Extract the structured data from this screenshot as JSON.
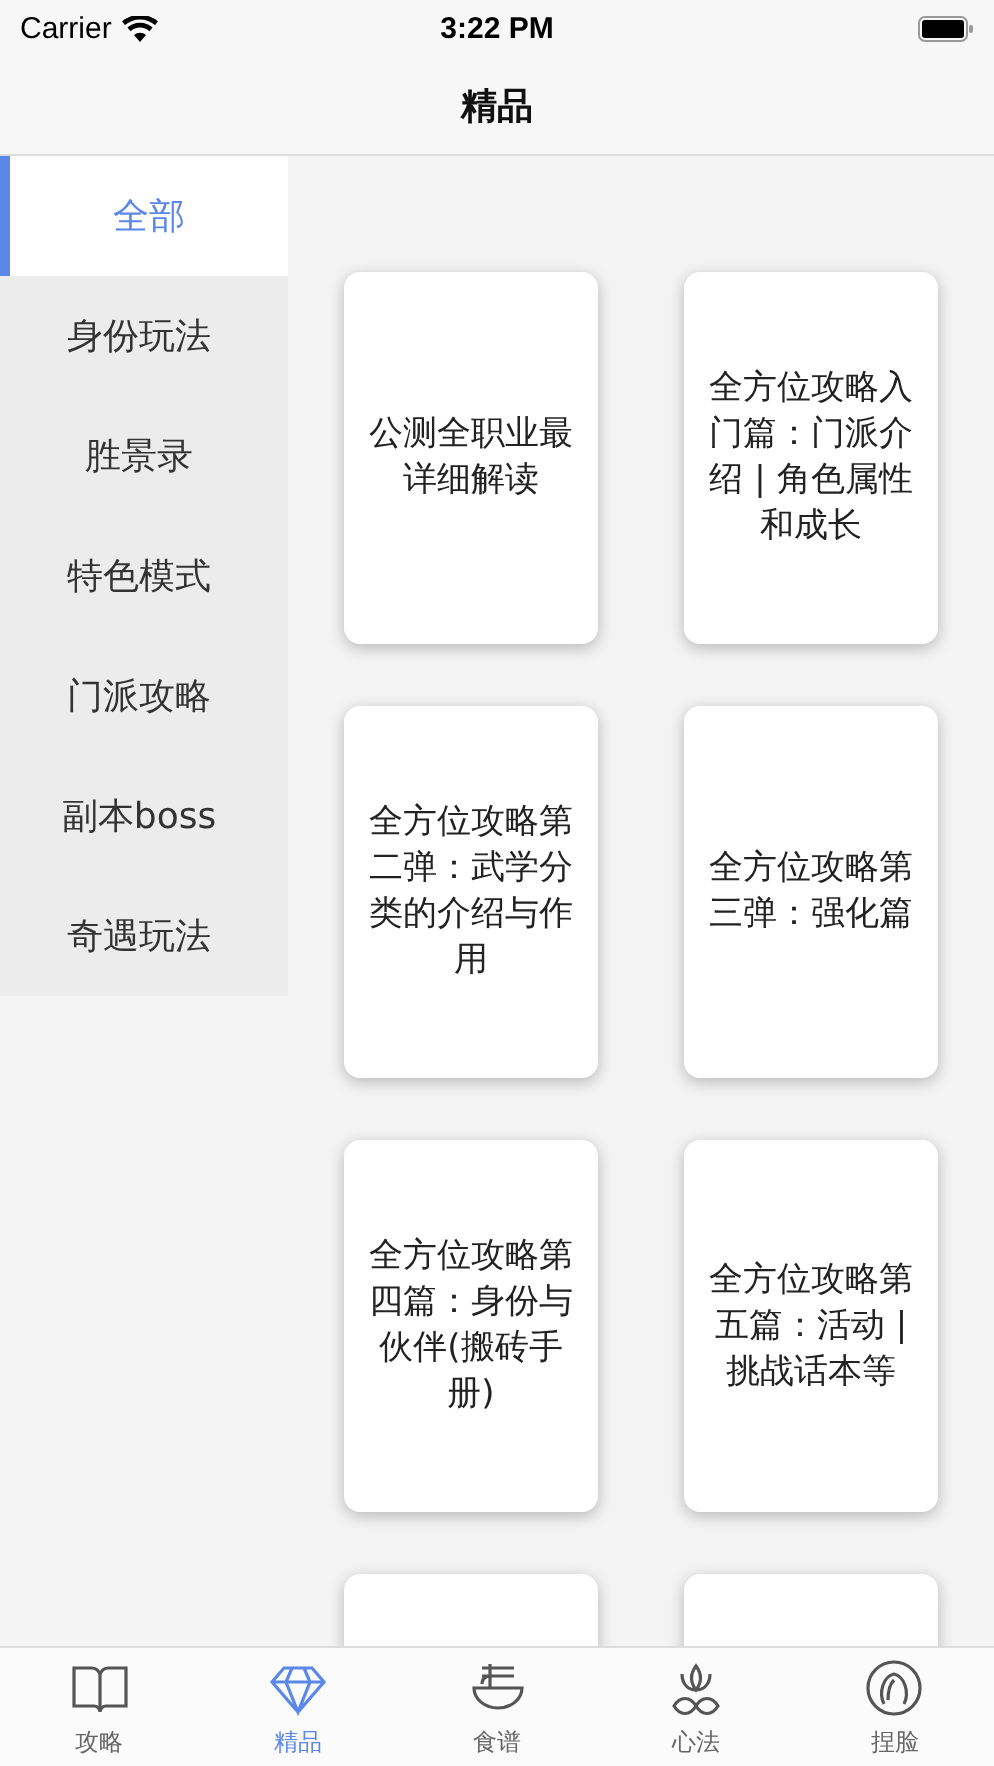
{
  "status_bar": {
    "carrier": "Carrier",
    "time": "3:22 PM"
  },
  "nav": {
    "title": "精品"
  },
  "sidebar": {
    "items": [
      {
        "label": "全部",
        "selected": true
      },
      {
        "label": "身份玩法",
        "selected": false
      },
      {
        "label": "胜景录",
        "selected": false
      },
      {
        "label": "特色模式",
        "selected": false
      },
      {
        "label": "门派攻略",
        "selected": false
      },
      {
        "label": "副本boss",
        "selected": false
      },
      {
        "label": "奇遇玩法",
        "selected": false
      }
    ]
  },
  "cards": [
    {
      "kind": "article",
      "title": "公测全职业最详细解读"
    },
    {
      "kind": "article",
      "title": "全方位攻略入门篇：门派介绍 | 角色属性和成长"
    },
    {
      "kind": "article",
      "title": "全方位攻略第二弹：武学分类的介绍与作用"
    },
    {
      "kind": "article",
      "title": "全方位攻略第三弹：强化篇"
    },
    {
      "kind": "article",
      "title": "全方位攻略第四篇：身份与伙伴(搬砖手册)"
    },
    {
      "kind": "article",
      "title": "全方位攻略第五篇：活动 | 挑战话本等"
    },
    {
      "kind": "cutoff"
    },
    {
      "kind": "cutoff"
    }
  ],
  "tab_bar": [
    {
      "label": "攻略",
      "selected": false
    },
    {
      "label": "精品",
      "selected": true
    },
    {
      "label": "食谱",
      "selected": false
    },
    {
      "label": "心法",
      "selected": false
    },
    {
      "label": "捏脸",
      "selected": false
    }
  ]
}
